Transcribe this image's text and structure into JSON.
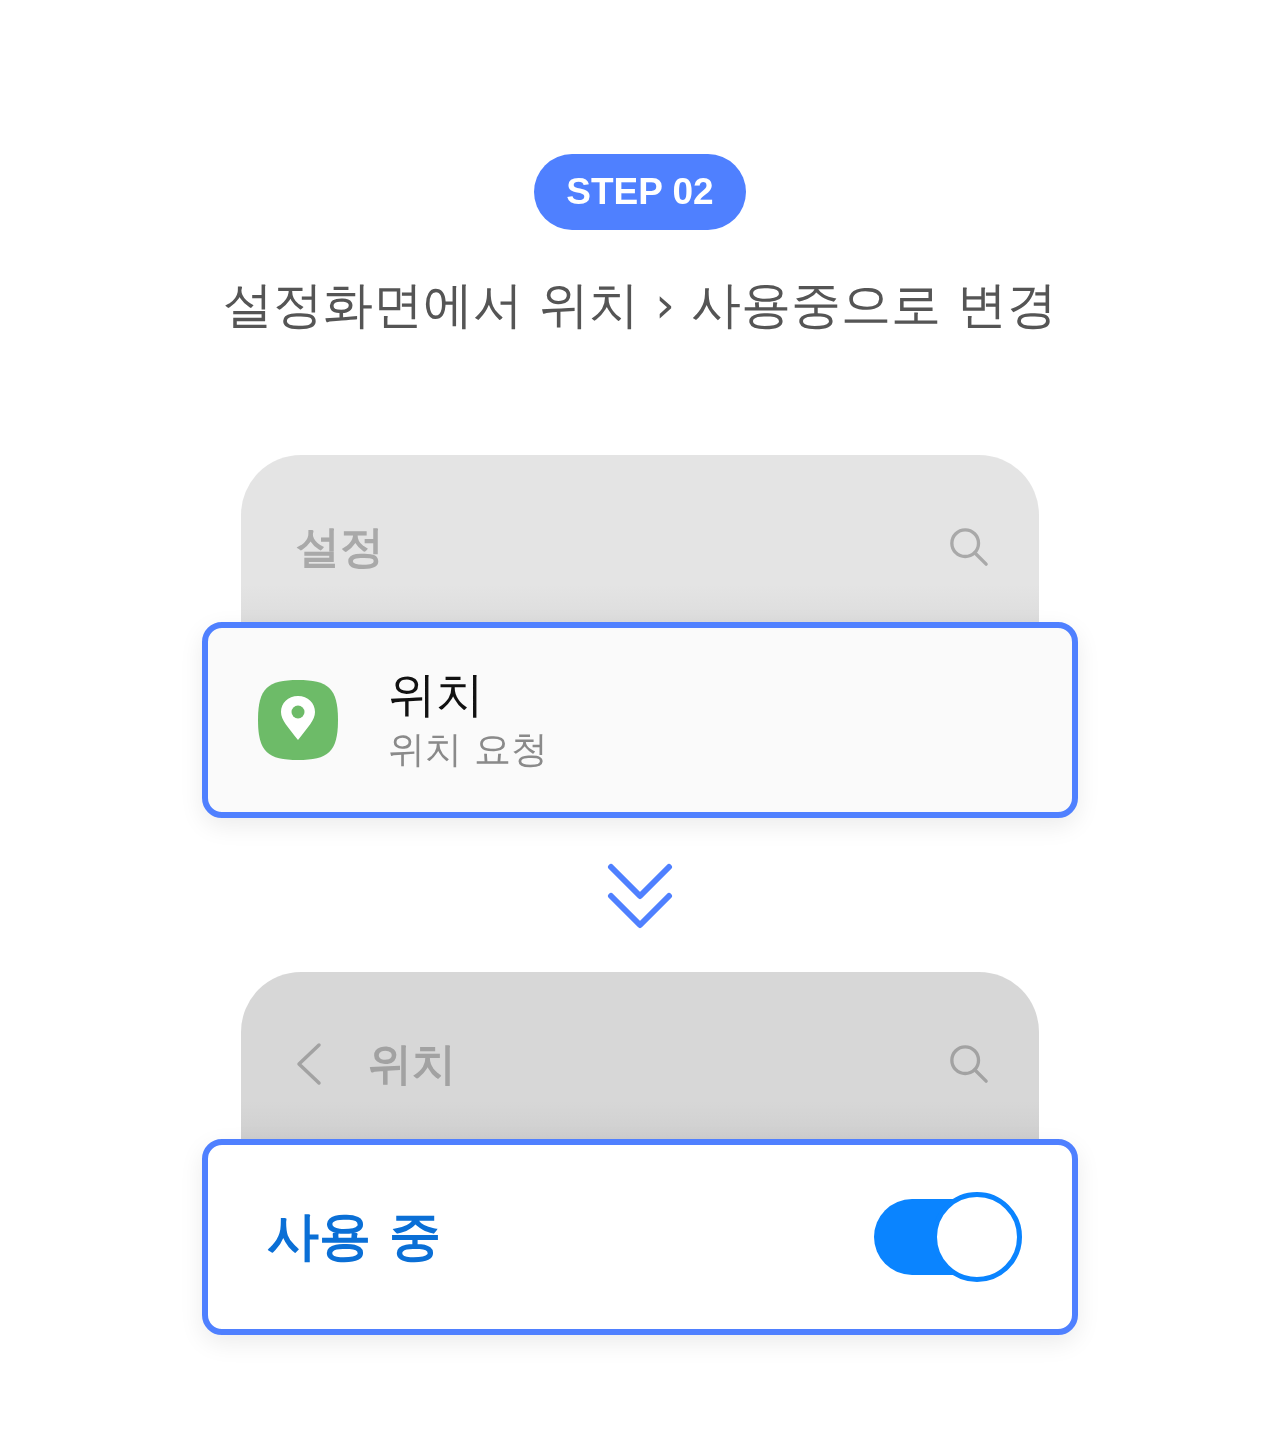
{
  "step_badge": "STEP 02",
  "instruction": "설정화면에서 위치 › 사용중으로 변경",
  "screens": [
    {
      "header": {
        "title": "설정",
        "back": false
      },
      "row": {
        "kind": "menu_item",
        "title": "위치",
        "subtitle": "위치 요청"
      }
    },
    {
      "header": {
        "title": "위치",
        "back": true
      },
      "row": {
        "kind": "switch",
        "label": "사용 중",
        "on": true
      }
    }
  ]
}
